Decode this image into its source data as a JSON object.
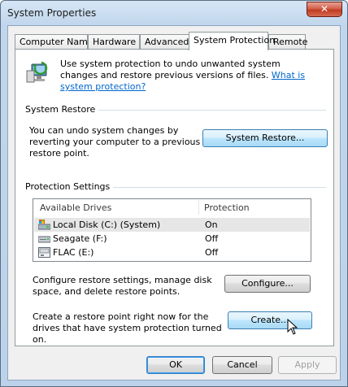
{
  "window": {
    "title": "System Properties",
    "close_label": "✕"
  },
  "tabs": [
    {
      "label": "Computer Name"
    },
    {
      "label": "Hardware"
    },
    {
      "label": "Advanced"
    },
    {
      "label": "System Protection"
    },
    {
      "label": "Remote"
    }
  ],
  "intro": {
    "text": "Use system protection to undo unwanted system changes and restore previous versions of files.",
    "link": "What is system protection?"
  },
  "system_restore": {
    "heading": "System Restore",
    "text": "You can undo system changes by reverting your computer to a previous restore point.",
    "button": "System Restore..."
  },
  "protection": {
    "heading": "Protection Settings",
    "columns": [
      "Available Drives",
      "Protection"
    ],
    "drives": [
      {
        "name": "Local Disk (C:) (System)",
        "protection": "On",
        "icon": "system-drive-icon"
      },
      {
        "name": "Seagate (F:)",
        "protection": "Off",
        "icon": "external-drive-icon"
      },
      {
        "name": "FLAC (E:)",
        "protection": "Off",
        "icon": "optical-drive-icon"
      }
    ],
    "configure_text": "Configure restore settings, manage disk space, and delete restore points.",
    "configure_button": "Configure...",
    "create_text": "Create a restore point right now for the drives that have system protection turned on.",
    "create_button": "Create..."
  },
  "footer": {
    "ok": "OK",
    "cancel": "Cancel",
    "apply": "Apply"
  }
}
